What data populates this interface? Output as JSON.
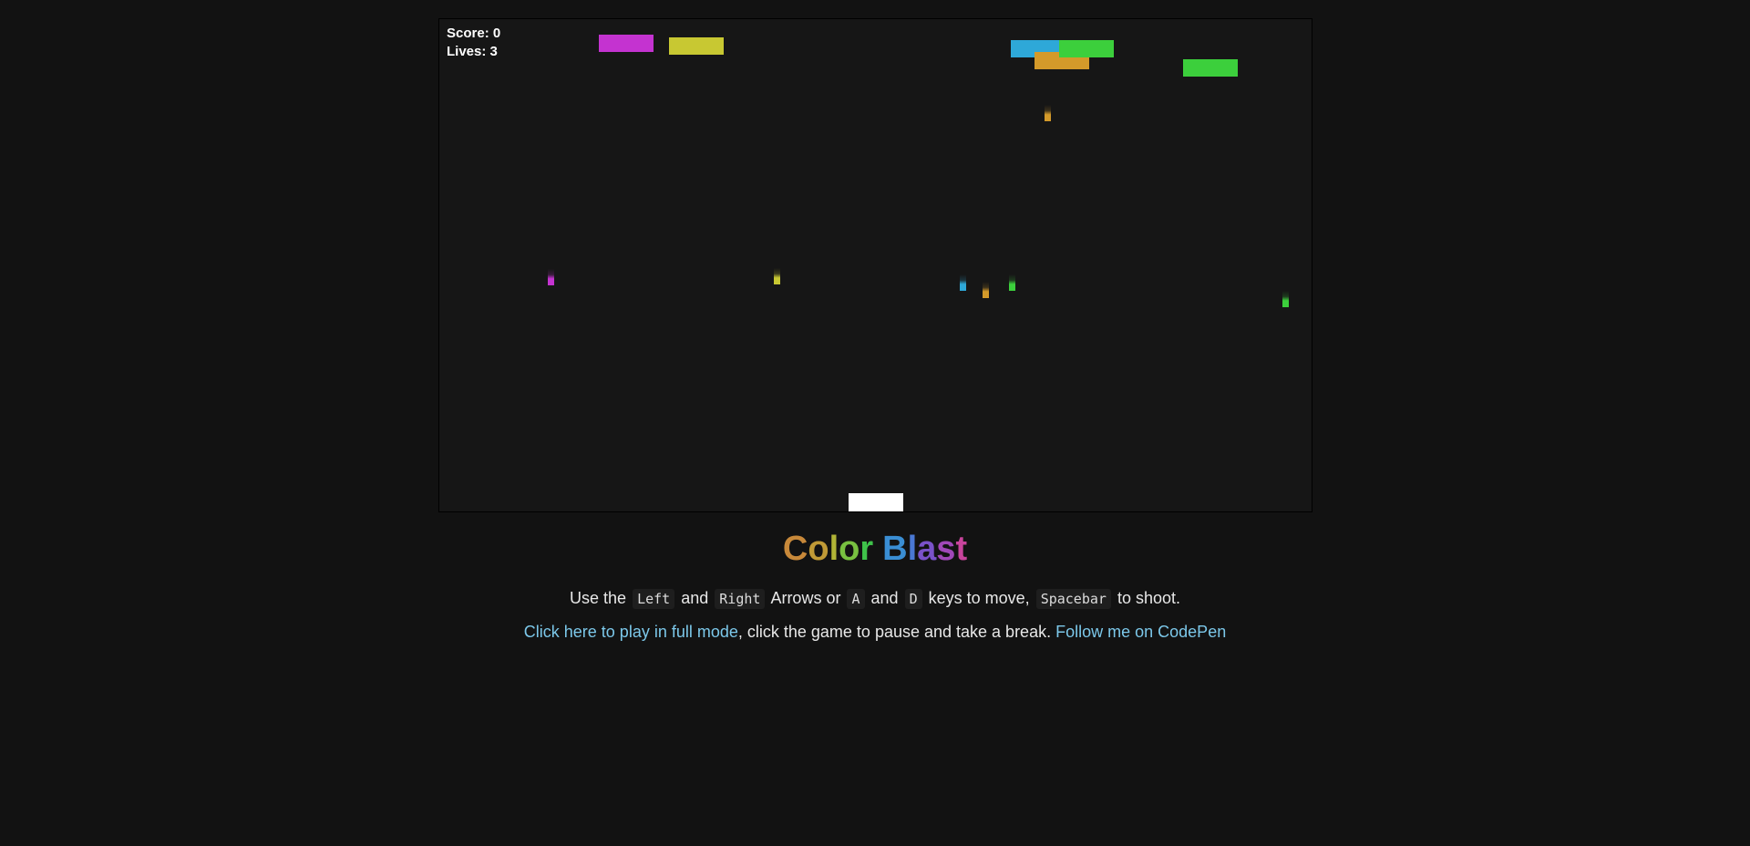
{
  "hud": {
    "score_label": "Score:",
    "score": 0,
    "lives_label": "Lives:",
    "lives": 3
  },
  "colors": {
    "background": "#121212",
    "canvas": "#161616",
    "magenta": "#c433d0",
    "yellow": "#c8c832",
    "blue": "#2ea8d8",
    "orange": "#d49a2a",
    "green": "#3ccf3c",
    "paddle": "#ffffff",
    "link": "#7cc8ea"
  },
  "bricks": [
    {
      "color": "magenta"
    },
    {
      "color": "yellow"
    },
    {
      "color": "blue"
    },
    {
      "color": "orange"
    },
    {
      "color": "green"
    },
    {
      "color": "green"
    }
  ],
  "bullets": [
    {
      "color": "orange"
    },
    {
      "color": "magenta"
    },
    {
      "color": "yellow"
    },
    {
      "color": "blue"
    },
    {
      "color": "orange"
    },
    {
      "color": "green"
    },
    {
      "color": "green"
    }
  ],
  "title": {
    "chars": [
      {
        "ch": "C",
        "color": "#c8893a"
      },
      {
        "ch": "o",
        "color": "#c09a36"
      },
      {
        "ch": "l",
        "color": "#b0b336"
      },
      {
        "ch": "o",
        "color": "#78c040"
      },
      {
        "ch": "r",
        "color": "#3fc24a"
      },
      {
        "ch": " ",
        "color": "#ffffff"
      },
      {
        "ch": "B",
        "color": "#3a8ed4"
      },
      {
        "ch": "l",
        "color": "#4a78d4"
      },
      {
        "ch": "a",
        "color": "#7a52c8"
      },
      {
        "ch": "s",
        "color": "#a048b8"
      },
      {
        "ch": "t",
        "color": "#c8449c"
      }
    ]
  },
  "instructions": {
    "t1": "Use the",
    "k1": "Left",
    "t2": "and",
    "k2": "Right",
    "t3": "Arrows or",
    "k3": "A",
    "t4": "and",
    "k4": "D",
    "t5": "keys to move,",
    "k5": "Spacebar",
    "t6": "to shoot."
  },
  "links": {
    "full_mode": "Click here to play in full mode",
    "middle": ", click the game to pause and take a break.",
    "follow": "Follow me on CodePen"
  }
}
